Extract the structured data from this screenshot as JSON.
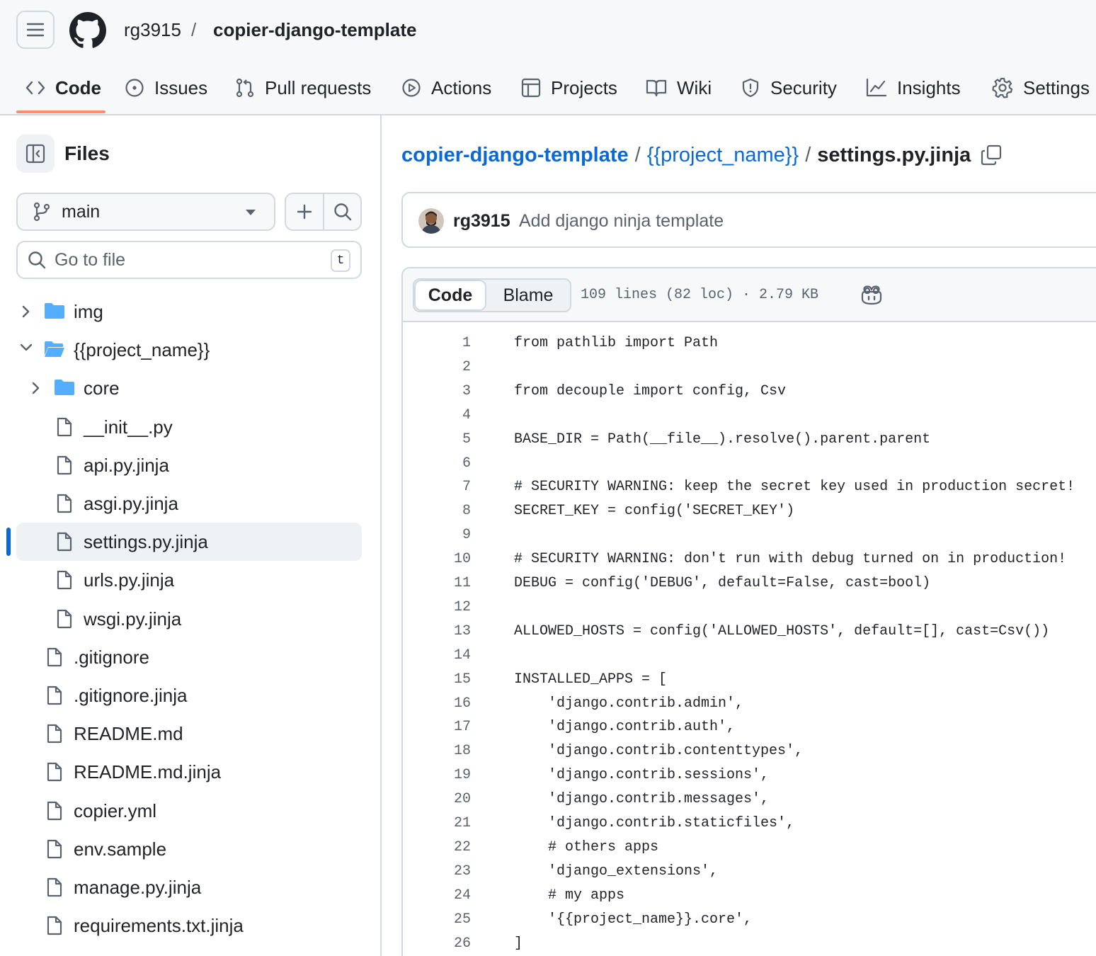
{
  "header": {
    "owner": "rg3915",
    "separator": "/",
    "repo": "copier-django-template"
  },
  "nav": {
    "tabs": [
      {
        "label": "Code",
        "icon": "code-icon",
        "active": true
      },
      {
        "label": "Issues",
        "icon": "issue-opened-icon"
      },
      {
        "label": "Pull requests",
        "icon": "git-pull-request-icon"
      },
      {
        "label": "Actions",
        "icon": "play-icon"
      },
      {
        "label": "Projects",
        "icon": "table-icon"
      },
      {
        "label": "Wiki",
        "icon": "book-icon"
      },
      {
        "label": "Security",
        "icon": "shield-icon"
      },
      {
        "label": "Insights",
        "icon": "graph-icon"
      },
      {
        "label": "Settings",
        "icon": "gear-icon"
      }
    ]
  },
  "sidebar": {
    "title": "Files",
    "branch": "main",
    "goto_placeholder": "Go to file",
    "goto_shortcut": "t",
    "tree": [
      {
        "name": "img",
        "type": "folder",
        "expanded": false,
        "depth": 0
      },
      {
        "name": "{{project_name}}",
        "type": "folder",
        "expanded": true,
        "depth": 0
      },
      {
        "name": "core",
        "type": "folder",
        "expanded": false,
        "depth": 1
      },
      {
        "name": "__init__.py",
        "type": "file",
        "depth": 1
      },
      {
        "name": "api.py.jinja",
        "type": "file",
        "depth": 1
      },
      {
        "name": "asgi.py.jinja",
        "type": "file",
        "depth": 1
      },
      {
        "name": "settings.py.jinja",
        "type": "file",
        "depth": 1,
        "selected": true
      },
      {
        "name": "urls.py.jinja",
        "type": "file",
        "depth": 1
      },
      {
        "name": "wsgi.py.jinja",
        "type": "file",
        "depth": 1
      },
      {
        "name": ".gitignore",
        "type": "file",
        "depth": 0
      },
      {
        "name": ".gitignore.jinja",
        "type": "file",
        "depth": 0
      },
      {
        "name": "README.md",
        "type": "file",
        "depth": 0
      },
      {
        "name": "README.md.jinja",
        "type": "file",
        "depth": 0
      },
      {
        "name": "copier.yml",
        "type": "file",
        "depth": 0
      },
      {
        "name": "env.sample",
        "type": "file",
        "depth": 0
      },
      {
        "name": "manage.py.jinja",
        "type": "file",
        "depth": 0
      },
      {
        "name": "requirements.txt.jinja",
        "type": "file",
        "depth": 0
      }
    ]
  },
  "main": {
    "breadcrumb": {
      "repo": "copier-django-template",
      "folder": "{{project_name}}",
      "file": "settings.py.jinja",
      "sep": "/"
    },
    "commit": {
      "author": "rg3915",
      "message": "Add django ninja template"
    },
    "file": {
      "tab_code": "Code",
      "tab_blame": "Blame",
      "meta": "109 lines (82 loc) · 2.79 KB"
    },
    "code_lines": [
      "from pathlib import Path",
      "",
      "from decouple import config, Csv",
      "",
      "BASE_DIR = Path(__file__).resolve().parent.parent",
      "",
      "# SECURITY WARNING: keep the secret key used in production secret!",
      "SECRET_KEY = config('SECRET_KEY')",
      "",
      "# SECURITY WARNING: don't run with debug turned on in production!",
      "DEBUG = config('DEBUG', default=False, cast=bool)",
      "",
      "ALLOWED_HOSTS = config('ALLOWED_HOSTS', default=[], cast=Csv())",
      "",
      "INSTALLED_APPS = [",
      "    'django.contrib.admin',",
      "    'django.contrib.auth',",
      "    'django.contrib.contenttypes',",
      "    'django.contrib.sessions',",
      "    'django.contrib.messages',",
      "    'django.contrib.staticfiles',",
      "    # others apps",
      "    'django_extensions',",
      "    # my apps",
      "    '{{project_name}}.core',",
      "]"
    ]
  },
  "colors": {
    "accent_link": "#0969da",
    "folder": "#54aeff",
    "tab_underline": "#fd8c73",
    "muted": "#59636e",
    "border": "#d1d9e0"
  }
}
